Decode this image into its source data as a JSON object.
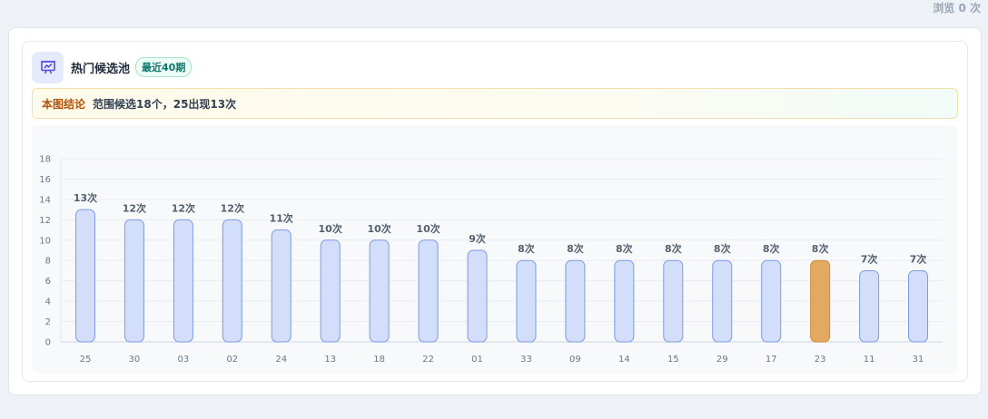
{
  "header": {
    "views": "浏览 0 次",
    "icon": "presentation-chart-icon",
    "title": "热门候选池",
    "badge": "最近40期"
  },
  "conclusion": {
    "label": "本图结论",
    "text": "范围候选18个，25出现13次"
  },
  "colors": {
    "bar_fill": "#d2defa",
    "bar_stroke": "#7c9be6",
    "highlight_fill": "#e3a963",
    "highlight_stroke": "#cf8a3c",
    "accent": "#4f46e5"
  },
  "chart_data": {
    "type": "bar",
    "categories": [
      "25",
      "30",
      "03",
      "02",
      "24",
      "13",
      "18",
      "22",
      "01",
      "33",
      "09",
      "14",
      "15",
      "29",
      "17",
      "23",
      "11",
      "31"
    ],
    "values": [
      13,
      12,
      12,
      12,
      11,
      10,
      10,
      10,
      9,
      8,
      8,
      8,
      8,
      8,
      8,
      8,
      7,
      7
    ],
    "data_labels": [
      "13次",
      "12次",
      "12次",
      "12次",
      "11次",
      "10次",
      "10次",
      "10次",
      "9次",
      "8次",
      "8次",
      "8次",
      "8次",
      "8次",
      "8次",
      "8次",
      "7次",
      "7次"
    ],
    "highlight_category": "23",
    "ylim": [
      0,
      18
    ],
    "yticks": [
      0,
      2,
      4,
      6,
      8,
      10,
      12,
      14,
      16,
      18
    ],
    "grid": true
  }
}
